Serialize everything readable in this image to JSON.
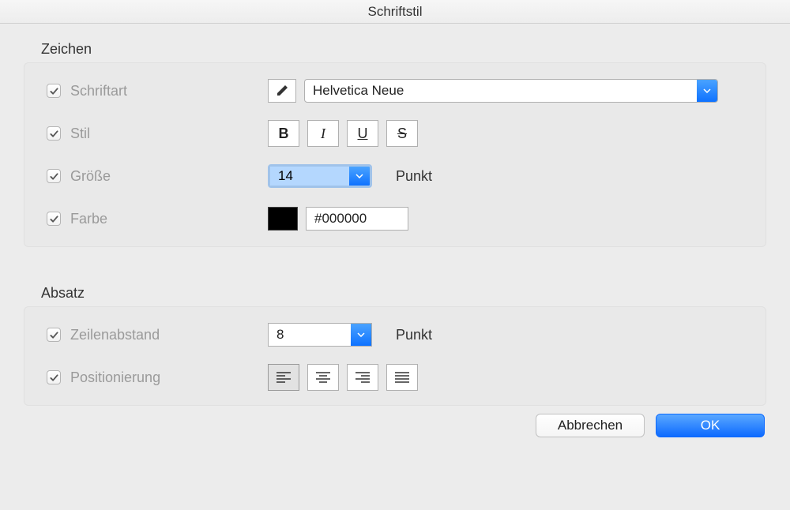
{
  "window": {
    "title": "Schriftstil"
  },
  "sections": {
    "characters": {
      "title": "Zeichen",
      "font": {
        "label": "Schriftart",
        "checked": true,
        "value": "Helvetica Neue"
      },
      "style": {
        "label": "Stil",
        "checked": true,
        "bold": "B",
        "italic": "I",
        "underline": "U",
        "strike": "S"
      },
      "size": {
        "label": "Größe",
        "checked": true,
        "value": "14",
        "unit": "Punkt"
      },
      "color": {
        "label": "Farbe",
        "checked": true,
        "swatch": "#000000",
        "value": "#000000"
      }
    },
    "paragraph": {
      "title": "Absatz",
      "line_spacing": {
        "label": "Zeilenabstand",
        "checked": true,
        "value": "8",
        "unit": "Punkt"
      },
      "positioning": {
        "label": "Positionierung",
        "checked": true,
        "active": "left"
      }
    }
  },
  "buttons": {
    "cancel": "Abbrechen",
    "ok": "OK"
  }
}
